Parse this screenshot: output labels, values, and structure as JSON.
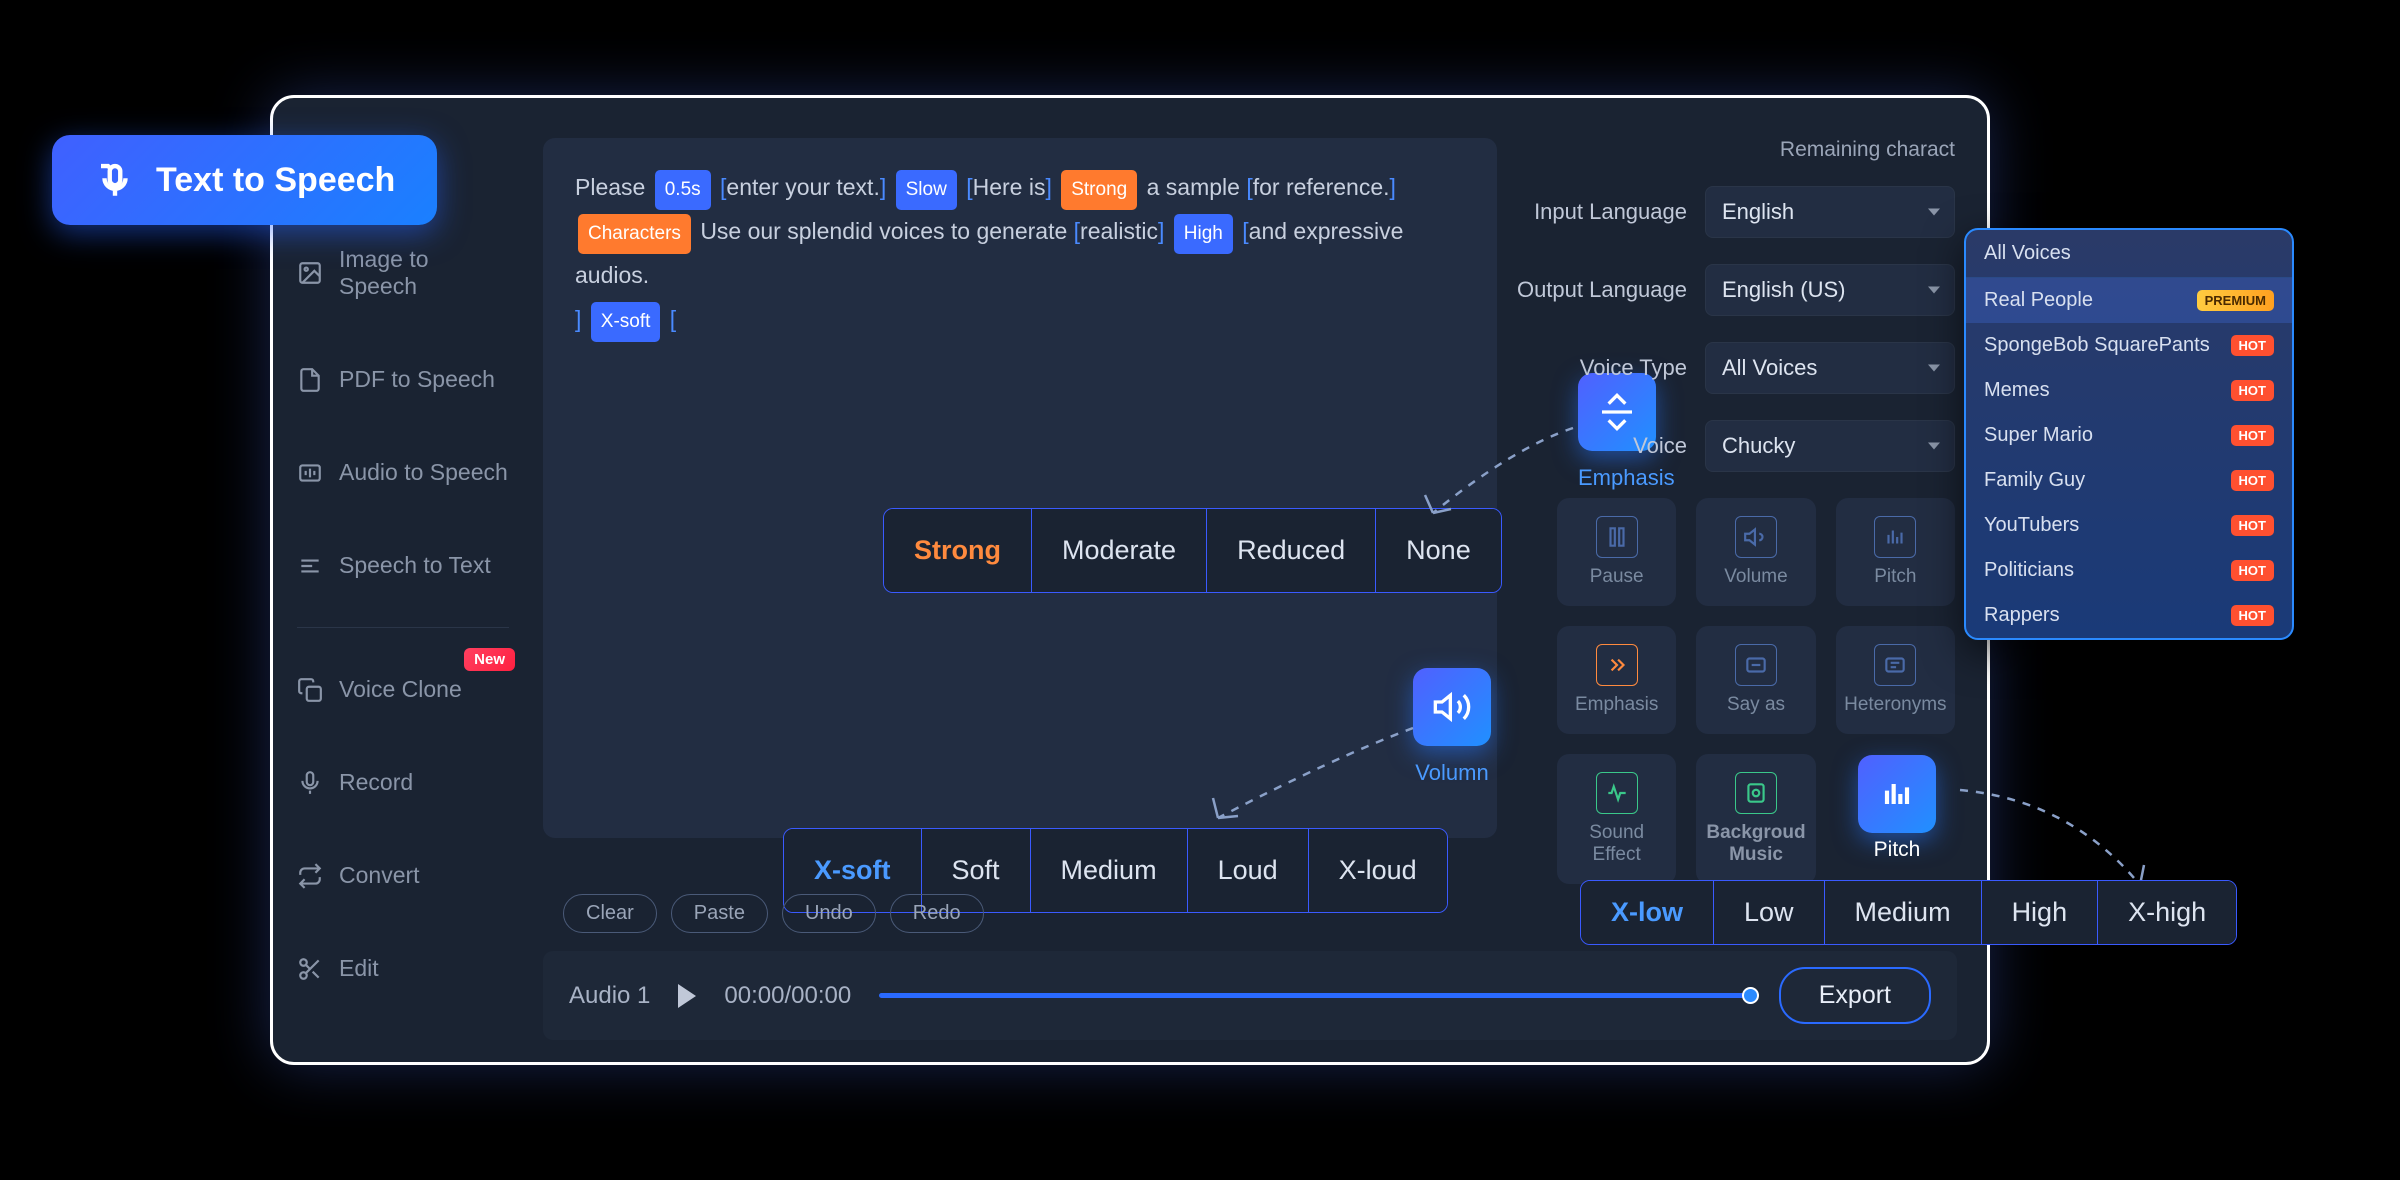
{
  "tts_tag": "Text  to Speech",
  "sidebar": {
    "items": [
      {
        "label": "Image to Speech"
      },
      {
        "label": "PDF to Speech"
      },
      {
        "label": "Audio to Speech"
      },
      {
        "label": "Speech to Text"
      },
      {
        "label": "Voice Clone",
        "badge": "New"
      },
      {
        "label": "Record"
      },
      {
        "label": "Convert"
      },
      {
        "label": "Edit"
      }
    ]
  },
  "editor": {
    "t1": "Please ",
    "chip_pause": "0.5s",
    "t2": "enter your text.",
    "chip_slow": "Slow",
    "t3": "Here is",
    "chip_strong": "Strong",
    "t4": " a sample ",
    "t5": "for reference.",
    "chip_chars": "Characters",
    "t6": " Use our splendid voices to generate ",
    "t7": "realistic",
    "chip_high": "High",
    "t8": "and expressive audios.",
    "chip_xsoft": "X-soft"
  },
  "emphasis": {
    "callout": "Emphasis",
    "options": [
      "Strong",
      "Moderate",
      "Reduced",
      "None"
    ],
    "active": 0
  },
  "volume": {
    "callout": "Volumn",
    "options": [
      "X-soft",
      "Soft",
      "Medium",
      "Loud",
      "X-loud"
    ],
    "active": 0
  },
  "pitch": {
    "callout": "Pitch",
    "options": [
      "X-low",
      "Low",
      "Medium",
      "High",
      "X-high"
    ],
    "active": 0
  },
  "right": {
    "remaining": "Remaining charact",
    "fields": [
      {
        "label": "Input Language",
        "value": "English"
      },
      {
        "label": "Output Language",
        "value": "English (US)"
      },
      {
        "label": "Voice Type",
        "value": "All Voices"
      },
      {
        "label": "Voice",
        "value": "Chucky"
      }
    ],
    "tools": [
      {
        "label": "Pause"
      },
      {
        "label": "Volume"
      },
      {
        "label": "Pitch"
      },
      {
        "label": "Emphasis"
      },
      {
        "label": "Say as"
      },
      {
        "label": "Heteronyms"
      },
      {
        "label": "Sound Effect"
      },
      {
        "label": "Backgroud Music"
      }
    ]
  },
  "actions": [
    "Clear",
    "Paste",
    "Undo",
    "Redo"
  ],
  "player": {
    "name": "Audio 1",
    "time": "00:00/00:00",
    "export": "Export"
  },
  "voice_dropdown": {
    "header": "All Voices",
    "items": [
      {
        "label": "Real People",
        "tag": "PREMIUM",
        "active": true
      },
      {
        "label": "SpongeBob SquarePants",
        "tag": "HOT"
      },
      {
        "label": "Memes",
        "tag": "HOT"
      },
      {
        "label": "Super Mario",
        "tag": "HOT"
      },
      {
        "label": "Family Guy",
        "tag": "HOT"
      },
      {
        "label": "YouTubers",
        "tag": "HOT"
      },
      {
        "label": "Politicians",
        "tag": "HOT"
      },
      {
        "label": "Rappers",
        "tag": "HOT"
      }
    ]
  }
}
